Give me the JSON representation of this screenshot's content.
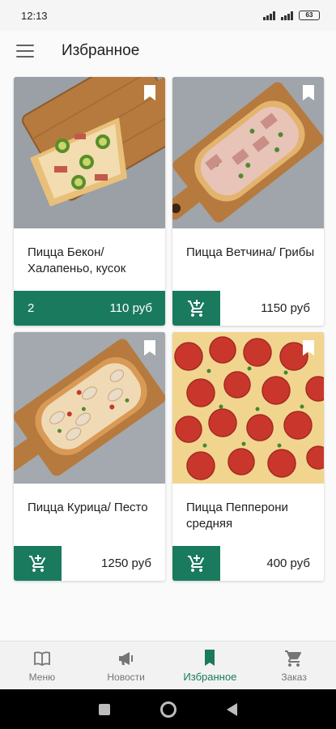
{
  "status_bar": {
    "time": "12:13",
    "battery": "63"
  },
  "app_bar": {
    "title": "Избранное",
    "menu_icon": "hamburger-menu-icon"
  },
  "colors": {
    "accent": "#1a7a5e",
    "background": "#fafafa",
    "card": "#ffffff"
  },
  "products": [
    {
      "name": "Пицца Бекон/ Халапеньо, кусок",
      "price": "110 руб",
      "quantity": "2",
      "in_cart": true
    },
    {
      "name": "Пицца Ветчина/ Грибы",
      "price": "1150 руб",
      "in_cart": false
    },
    {
      "name": "Пицца Курица/ Песто",
      "price": "1250 руб",
      "in_cart": false
    },
    {
      "name": "Пицца Пепперони средняя",
      "price": "400 руб",
      "in_cart": false
    }
  ],
  "bottom_nav": {
    "items": [
      {
        "label": "Меню",
        "icon": "book-icon"
      },
      {
        "label": "Новости",
        "icon": "megaphone-icon"
      },
      {
        "label": "Избранное",
        "icon": "bookmark-icon",
        "active": true
      },
      {
        "label": "Заказ",
        "icon": "cart-icon"
      }
    ]
  }
}
